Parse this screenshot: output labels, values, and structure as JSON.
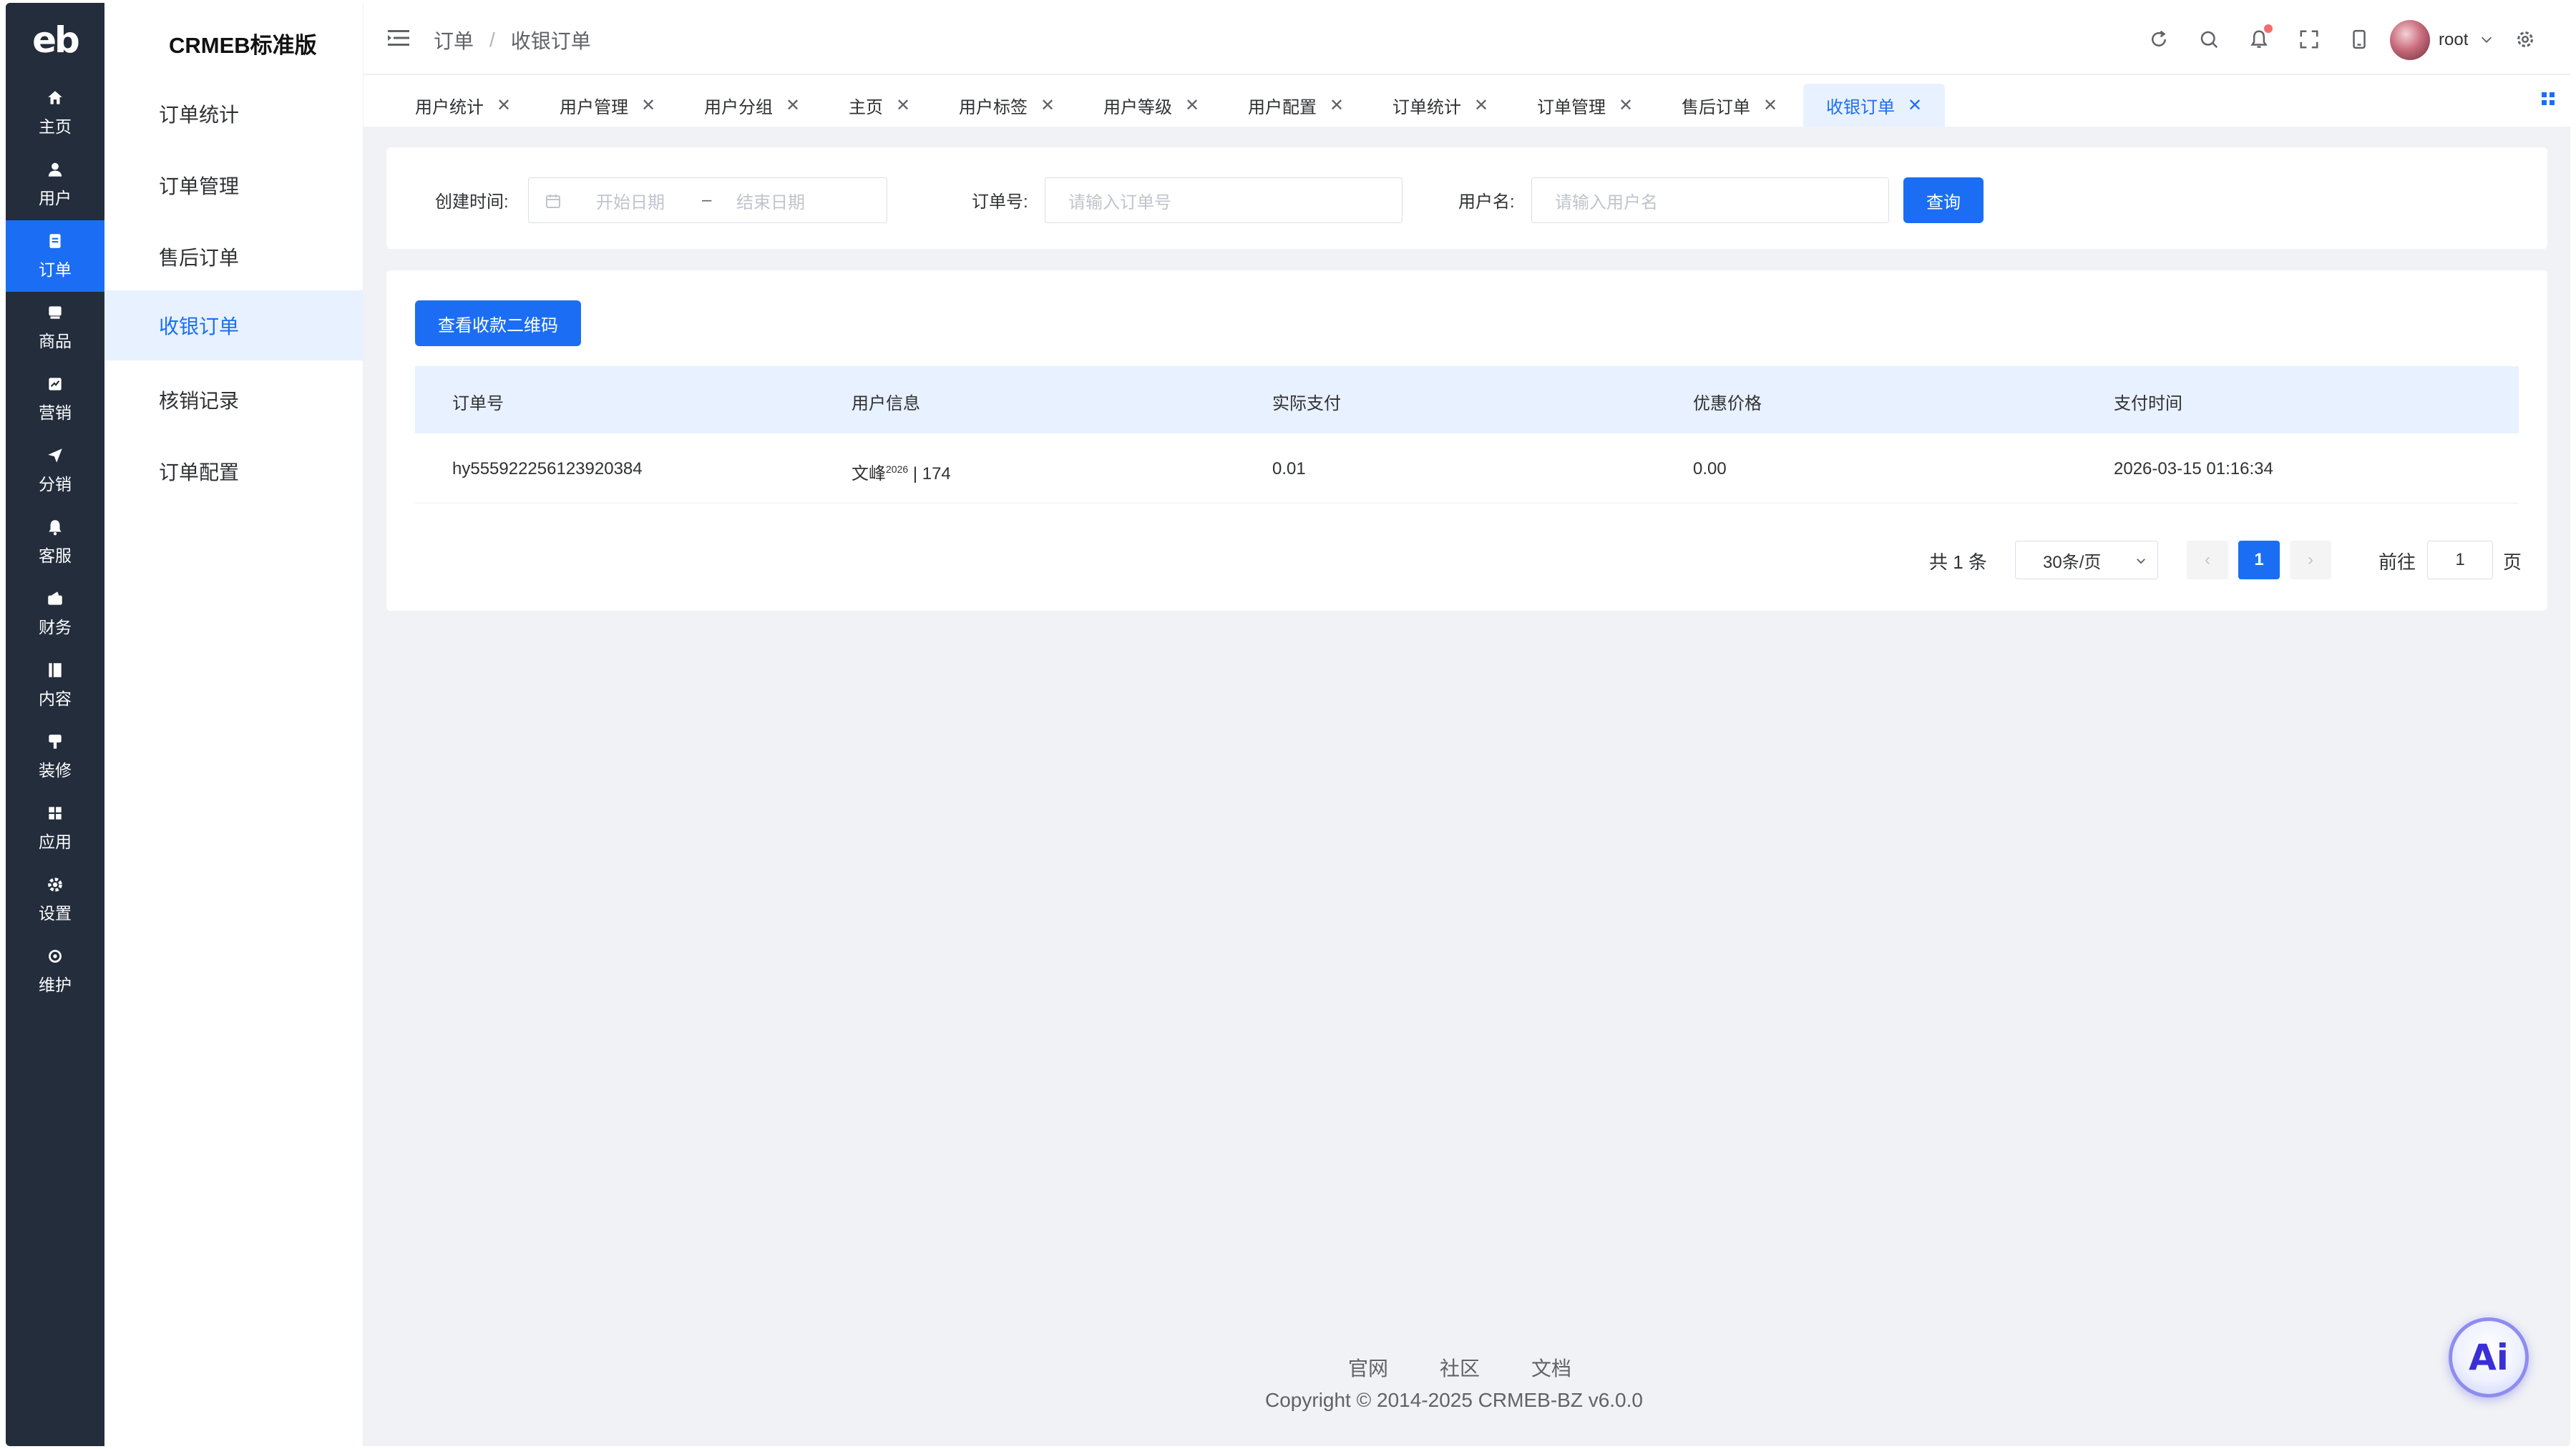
{
  "brand": {
    "logo": "eb",
    "name": "CRMEB标准版"
  },
  "rail": [
    {
      "label": "主页",
      "icon": "home-icon"
    },
    {
      "label": "用户",
      "icon": "user-icon"
    },
    {
      "label": "订单",
      "icon": "order-icon",
      "active": true
    },
    {
      "label": "商品",
      "icon": "goods-icon"
    },
    {
      "label": "营销",
      "icon": "marketing-icon"
    },
    {
      "label": "分销",
      "icon": "send-icon"
    },
    {
      "label": "客服",
      "icon": "bell-icon"
    },
    {
      "label": "财务",
      "icon": "finance-icon"
    },
    {
      "label": "内容",
      "icon": "content-icon"
    },
    {
      "label": "装修",
      "icon": "decorate-icon"
    },
    {
      "label": "应用",
      "icon": "grid-icon"
    },
    {
      "label": "设置",
      "icon": "gear-icon"
    },
    {
      "label": "维护",
      "icon": "maintain-icon"
    }
  ],
  "submenu": [
    {
      "label": "订单统计"
    },
    {
      "label": "订单管理"
    },
    {
      "label": "售后订单"
    },
    {
      "label": "收银订单",
      "active": true
    },
    {
      "label": "核销记录"
    },
    {
      "label": "订单配置"
    }
  ],
  "breadcrumb": {
    "parent": "订单",
    "sep": "/",
    "current": "收银订单"
  },
  "user": {
    "name": "root"
  },
  "tabs": [
    {
      "label": "用户统计"
    },
    {
      "label": "用户管理"
    },
    {
      "label": "用户分组"
    },
    {
      "label": "主页"
    },
    {
      "label": "用户标签"
    },
    {
      "label": "用户等级"
    },
    {
      "label": "用户配置"
    },
    {
      "label": "订单统计"
    },
    {
      "label": "订单管理"
    },
    {
      "label": "售后订单"
    },
    {
      "label": "收银订单",
      "active": true
    }
  ],
  "filters": {
    "created_label": "创建时间:",
    "start_placeholder": "开始日期",
    "range_sep": "–",
    "end_placeholder": "结束日期",
    "order_label": "订单号:",
    "order_placeholder": "请输入订单号",
    "user_label": "用户名:",
    "user_placeholder": "请输入用户名",
    "query_button": "查询"
  },
  "qr_button": "查看收款二维码",
  "table": {
    "columns": [
      "订单号",
      "用户信息",
      "实际支付",
      "优惠价格",
      "支付时间"
    ],
    "rows": [
      {
        "order_no": "hy555922256123920384",
        "user_name": "文峰",
        "user_sup": "2026",
        "user_rest": " | 174",
        "paid": "0.01",
        "discount": "0.00",
        "time": "2026-03-15 01:16:34"
      }
    ]
  },
  "pagination": {
    "total": "共 1 条",
    "page_size": "30条/页",
    "current": "1",
    "goto_label": "前往",
    "goto_value": "1",
    "page_unit": "页"
  },
  "footer": {
    "links": [
      "官网",
      "社区",
      "文档"
    ],
    "copyright": "Copyright © 2014-2025 CRMEB-BZ v6.0.0"
  },
  "ai_button": "Ai",
  "colors": {
    "primary": "#1b6ef3",
    "rail_bg": "#232d3c",
    "page_bg": "#f0f2f5",
    "active_light": "#e8f1ff"
  }
}
